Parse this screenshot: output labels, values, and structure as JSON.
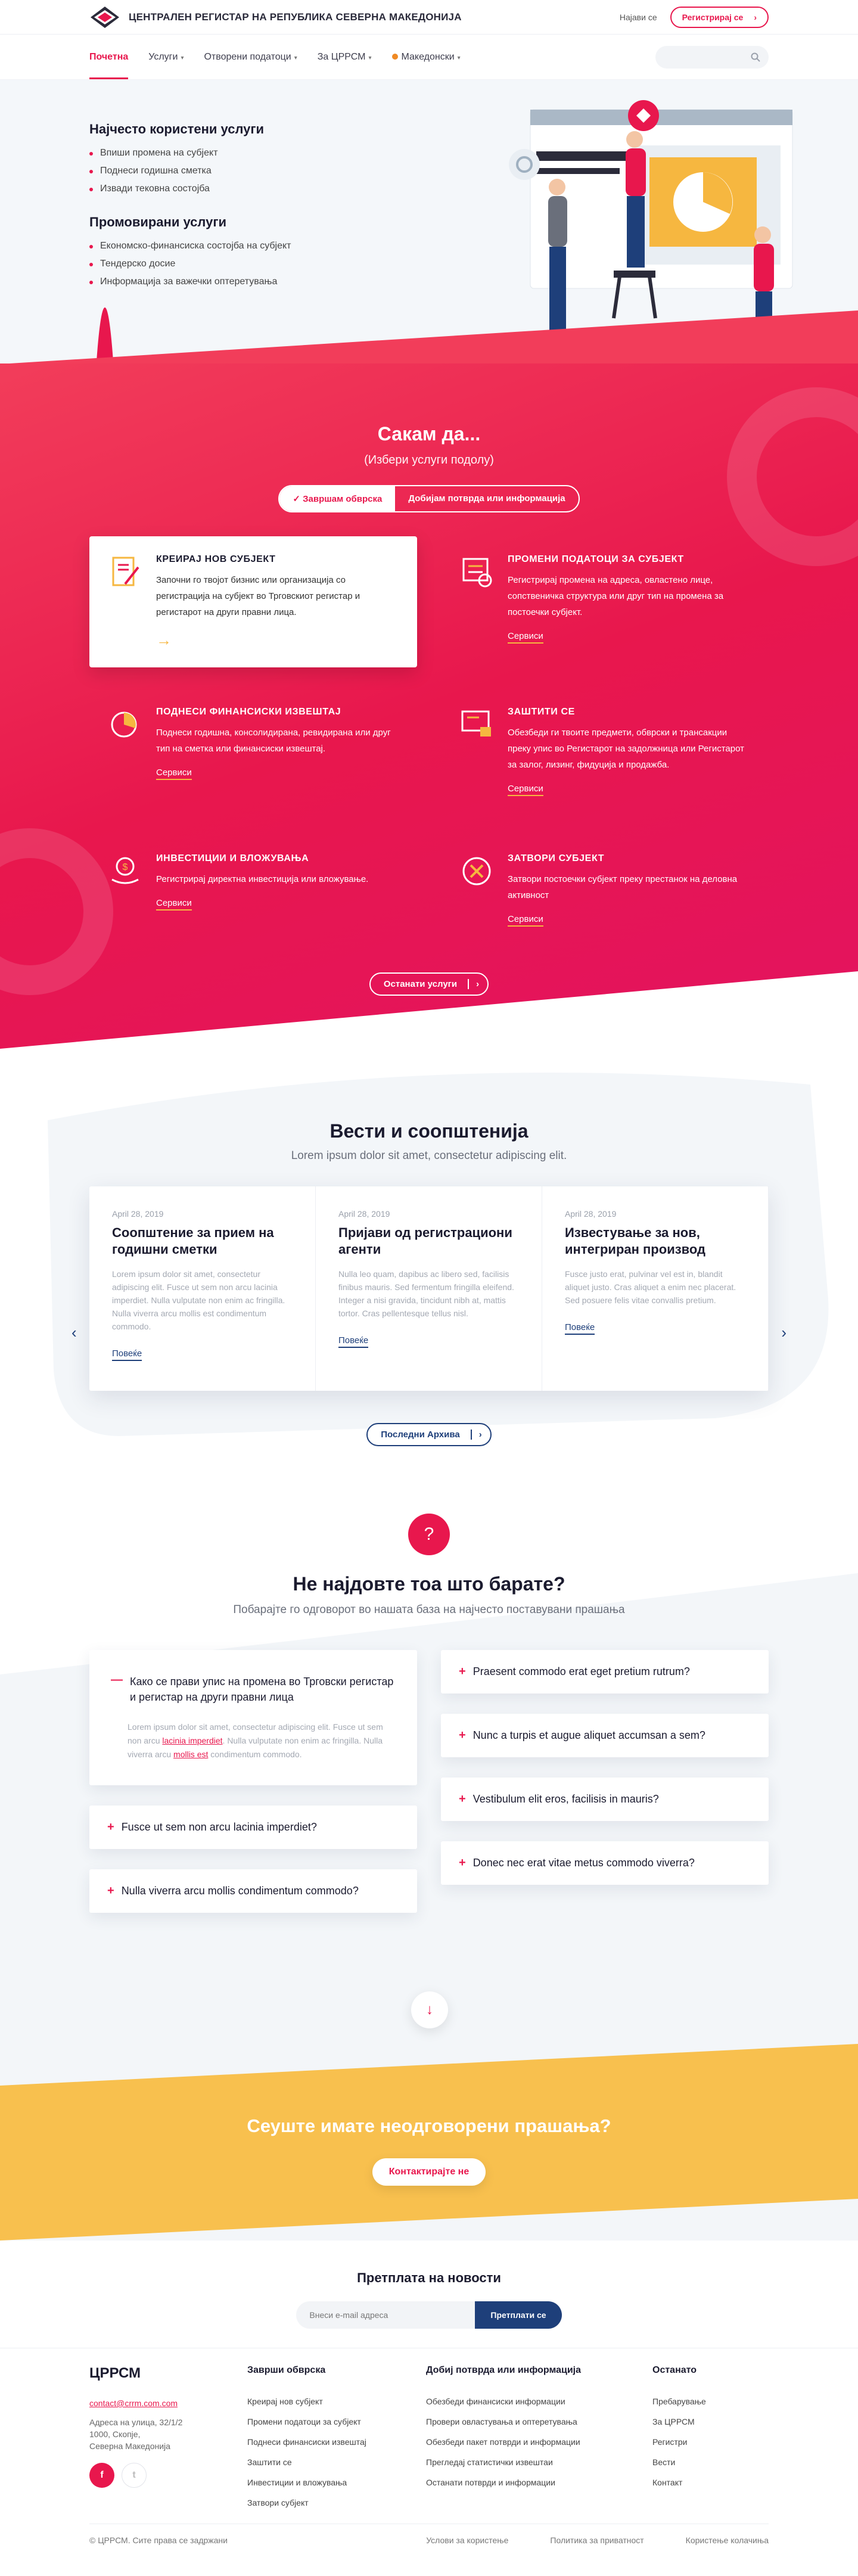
{
  "header": {
    "brand": "ЦЕНТРАЛЕН РЕГИСТАР НА РЕПУБЛИКА СЕВЕРНА МАКЕДОНИЈА",
    "login": "Најави се",
    "register": "Регистрирај се",
    "nav": [
      "Почетна",
      "Услуги",
      "Отворени податоци",
      "За ЦРРСМ",
      "Македонски"
    ],
    "accent": "#e8174d"
  },
  "hero": {
    "title1": "Најчесто користени услуги",
    "list1": [
      "Впиши промена на субјект",
      "Поднеси годишна сметка",
      "Извади тековна состојба"
    ],
    "title2": "Промовирани услуги",
    "list2": [
      "Економско-финансиска состојба на субјект",
      "Тендерско досие",
      "Информација за важечки оптеретувања"
    ]
  },
  "services": {
    "title": "Сакам да...",
    "subtitle": "(Избери услуги подолу)",
    "tab_active": "Завршам обврска",
    "tab_other": "Добијам потврда или информација",
    "items": [
      {
        "title": "КРЕИРАЈ НОВ СУБЈЕКТ",
        "text": "Започни го твојот бизнис или организација со регистрација на субјект во Трговскиот регистар и регистарот на други правни лица.",
        "link": ""
      },
      {
        "title": "ПРОМЕНИ ПОДАТОЦИ ЗА СУБЈЕКТ",
        "text": "Регистрирај промена на адреса, овластено лице, сопственичка структура или друг тип на промена за постоечки субјект.",
        "link": "Сервиси"
      },
      {
        "title": "ПОДНЕСИ ФИНАНСИСКИ ИЗВЕШТАЈ",
        "text": "Поднеси годишна, консолидирана, ревидирана или друг тип на сметка или финансиски извештај.",
        "link": "Сервиси"
      },
      {
        "title": "ЗАШТИТИ СЕ",
        "text": "Обезбеди ги твоите предмети, обврски и трансакции преку упис во Регистарот на задолжница или Регистарот за залог, лизинг, фидуција и продажба.",
        "link": "Сервиси"
      },
      {
        "title": "ИНВЕСТИЦИИ И ВЛОЖУВАЊА",
        "text": "Регистрирај директна инвестиција или вложување.",
        "link": "Сервиси"
      },
      {
        "title": "ЗАТВОРИ СУБЈЕКТ",
        "text": "Затвори постоечки субјект преку престанок на деловна активност",
        "link": "Сервиси"
      }
    ],
    "other_button": "Останати услуги"
  },
  "news": {
    "title": "Вести и соопштенија",
    "subtitle": "Lorem ipsum dolor sit amet, consectetur adipiscing elit.",
    "items": [
      {
        "date": "April 28, 2019",
        "title": "Соопштение за прием на годишни сметки",
        "text": "Lorem ipsum dolor sit amet, consectetur adipiscing elit. Fusce ut sem non arcu lacinia imperdiet. Nulla vulputate non enim ac fringilla. Nulla viverra arcu mollis est condimentum commodo.",
        "more": "Повеќе"
      },
      {
        "date": "April 28, 2019",
        "title": "Пријави од регистрациони агенти",
        "text": "Nulla leo quam, dapibus ac libero sed, facilisis finibus mauris. Sed fermentum fringilla eleifend. Integer a nisi gravida, tincidunt nibh at, mattis tortor. Cras pellentesque tellus nisl.",
        "more": "Повеќе"
      },
      {
        "date": "April 28, 2019",
        "title": "Известување за нов, интегриран производ",
        "text": "Fusce justo erat, pulvinar vel est in, blandit aliquet justo. Cras aliquet a enim nec placerat. Sed posuere felis vitae convallis pretium.",
        "more": "Повеќе"
      }
    ],
    "archive": "Последни Архива"
  },
  "faq": {
    "title": "Не најдовте тоа што барате?",
    "subtitle": "Побарајте го одговорот во нашата база на најчесто поставувани прашања",
    "open_q": "Како се прави упис на промена во Трговски регистар и регистар на други правни лица",
    "open_a_1": "Lorem ipsum dolor sit amet, consectetur adipiscing elit. Fusce ut sem non arcu ",
    "open_a_link1": "lacinia imperdiet",
    "open_a_2": ". Nulla vulputate non enim ac fringilla. Nulla viverra arcu ",
    "open_a_link2": "mollis est",
    "open_a_3": " condimentum commodo.",
    "left": [
      "Fusce ut sem non arcu lacinia imperdiet?",
      "Nulla viverra arcu mollis condimentum commodo?"
    ],
    "right": [
      "Praesent commodo erat eget pretium rutrum?",
      "Nunc a turpis et augue aliquet accumsan a sem?",
      "Vestibulum elit eros, facilisis in mauris?",
      "Donec nec erat vitae metus commodo viverra?"
    ]
  },
  "cta": {
    "title": "Сеуште имате неодговорени прашања?",
    "button": "Контактирајте не"
  },
  "newsletter": {
    "title": "Претплата на новости",
    "placeholder": "Внеси e-mail адреса",
    "button": "Претплати се"
  },
  "footer": {
    "brand": "ЦРРСМ",
    "email": "contact@crrm.com.com",
    "address": [
      "Адреса на улица, 32/1/2",
      "1000, Скопје,",
      "Северна Македонија"
    ],
    "col1_title": "Заврши обврска",
    "col1": [
      "Креирај нов субјект",
      "Промени податоци за субјект",
      "Поднеси финансиски извештај",
      "Заштити се",
      "Инвестиции и вложувања",
      "Затвори субјект"
    ],
    "col2_title": "Добиј потврда или информација",
    "col2": [
      "Обезбеди финансиски информации",
      "Провери овластувања и оптеретувања",
      "Обезбеди пакет потврди и информации",
      "Прегледај статистички извештаи",
      "Останати потврди и информации"
    ],
    "col3_title": "Останато",
    "col3": [
      "Пребарување",
      "За ЦРРСМ",
      "Регистри",
      "Вести",
      "Контакт"
    ],
    "copyright": "© ЦРРСМ. Сите права се задржани",
    "links": [
      "Услови за користење",
      "Политика за приватност",
      "Користење колачиња"
    ]
  }
}
